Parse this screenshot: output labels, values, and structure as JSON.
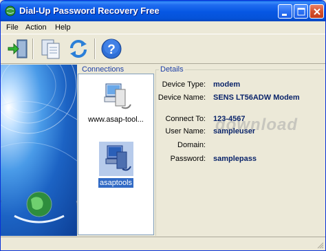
{
  "window": {
    "title": "Dial-Up Password Recovery Free"
  },
  "menu": {
    "file": "File",
    "action": "Action",
    "help": "Help"
  },
  "toolbar": {
    "icons": [
      "exit-door-icon",
      "copy-icon",
      "refresh-icon",
      "help-icon"
    ]
  },
  "connections": {
    "label": "Connections",
    "items": [
      {
        "label": "www.asap-tool...",
        "icon": "computer-network-icon",
        "selected": false
      },
      {
        "label": "asaptools",
        "icon": "dialup-connection-icon",
        "selected": true
      }
    ]
  },
  "details": {
    "label": "Details",
    "device_type_label": "Device Type:",
    "device_type": "modem",
    "device_name_label": "Device Name:",
    "device_name": "SENS LT56ADW Modem",
    "connect_to_label": "Connect To:",
    "connect_to": "123-4567",
    "user_name_label": "User Name:",
    "user_name": "sampleuser",
    "domain_label": "Domain:",
    "domain": "",
    "password_label": "Password:",
    "password": "samplepass"
  },
  "watermark": "download",
  "colors": {
    "titlebar": "#0553d9",
    "selection": "#316ac5",
    "value_text": "#0a246a",
    "group_label": "#1c3ea6"
  }
}
